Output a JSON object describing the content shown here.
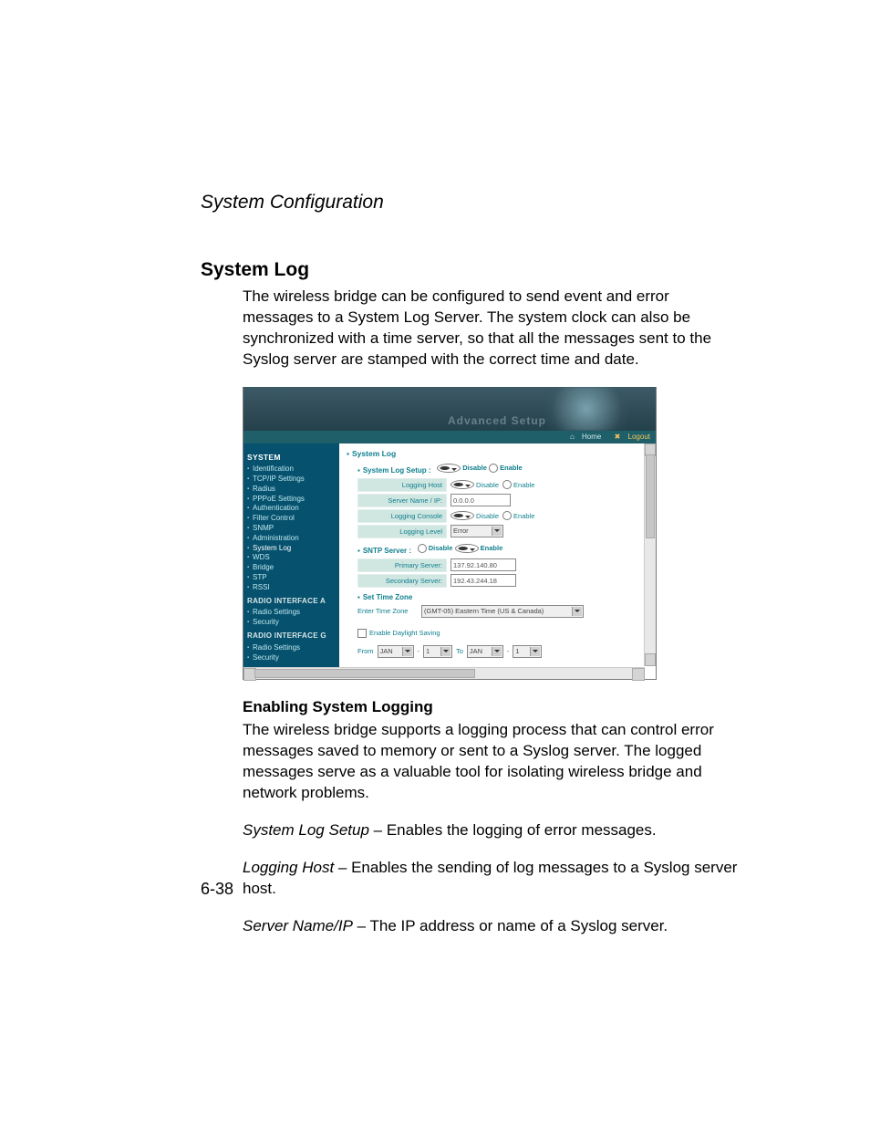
{
  "chapter_title": "System Configuration",
  "section_title": "System Log",
  "intro_paragraph": "The wireless bridge can be configured to send event and error messages to a System Log Server. The system clock can also be synchronized with a time server, so that all the messages sent to the Syslog server are stamped with the correct time and date.",
  "subsection_title": "Enabling System Logging",
  "enabling_paragraph": "The wireless bridge supports a logging process that can control error messages saved to memory or sent to a Syslog server. The logged messages serve as a valuable tool for isolating wireless bridge and network problems.",
  "defs": {
    "system_log_setup": {
      "term": "System Log Setup",
      "desc": " – Enables the logging of error messages."
    },
    "logging_host": {
      "term": "Logging Host",
      "desc": " – Enables the sending of log messages to a Syslog server host."
    },
    "server_name_ip": {
      "term": "Server Name/IP",
      "desc": " – The IP address or name of a Syslog server."
    }
  },
  "page_number": "6-38",
  "screenshot": {
    "banner_caption": "Advanced Setup",
    "topbar": {
      "home": "Home",
      "logout": "Logout"
    },
    "sidebar": {
      "group_system": "SYSTEM",
      "system_items": [
        "Identification",
        "TCP/IP Settings",
        "Radius",
        "PPPoE Settings",
        "Authentication",
        "Filter Control",
        "SNMP",
        "Administration",
        "System Log",
        "WDS",
        "Bridge",
        "STP",
        "RSSI"
      ],
      "active_system_index": 8,
      "group_radio_a": "RADIO INTERFACE A",
      "radio_a_items": [
        "Radio Settings",
        "Security"
      ],
      "group_radio_g": "RADIO INTERFACE G",
      "radio_g_items": [
        "Radio Settings",
        "Security"
      ]
    },
    "content": {
      "crumb": "System Log",
      "syslog_setup": {
        "label": "System Log Setup :",
        "disable": "Disable",
        "enable": "Enable",
        "selected": "disable"
      },
      "logging_host_row": {
        "label": "Logging Host",
        "disable": "Disable",
        "enable": "Enable",
        "selected": "disable"
      },
      "server_row": {
        "label": "Server Name / IP:",
        "value": "0.0.0.0"
      },
      "logging_console_row": {
        "label": "Logging Console",
        "disable": "Disable",
        "enable": "Enable",
        "selected": "disable"
      },
      "logging_level_row": {
        "label": "Logging Level",
        "value": "Error"
      },
      "sntp": {
        "label": "SNTP Server :",
        "disable": "Disable",
        "enable": "Enable",
        "selected": "enable"
      },
      "primary_row": {
        "label": "Primary Server:",
        "value": "137.92.140.80"
      },
      "secondary_row": {
        "label": "Secondary Server:",
        "value": "192.43.244.18"
      },
      "set_time_zone": "Set Time Zone",
      "enter_time_zone": {
        "label": "Enter Time Zone",
        "value": "(GMT-05) Eastern Time (US & Canada)"
      },
      "daylight": {
        "checkbox_label": "Enable Daylight Saving",
        "from": "From",
        "to": "To",
        "from_month": "JAN",
        "from_day": "1",
        "to_month": "JAN",
        "to_day": "1"
      }
    }
  }
}
